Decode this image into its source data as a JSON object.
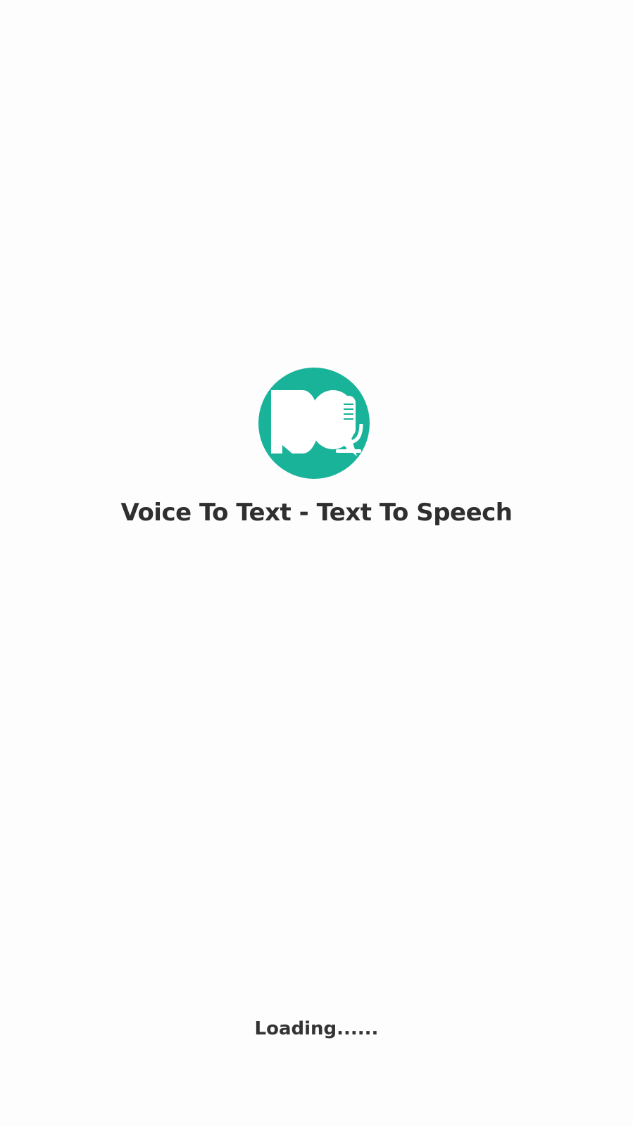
{
  "splash": {
    "app_title": "Voice To Text - Text To Speech",
    "loading_text": "Loading......",
    "logo_icon": "chat-bubbles-microphone-icon"
  },
  "colors": {
    "background": "#fdfdfd",
    "accent": "#19b39a",
    "title_text": "#2f2f2f",
    "loading_text": "#333333"
  }
}
